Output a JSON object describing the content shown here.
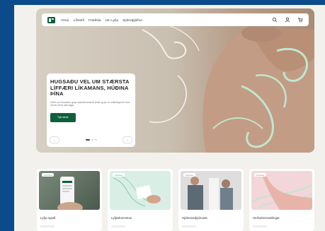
{
  "nav": {
    "items": [
      "Vörur",
      "Lífsstíll",
      "Fræðsla",
      "Um Lyfju",
      "Sjúkraþjálfun"
    ],
    "icons": [
      "search-icon",
      "user-icon",
      "cart-icon"
    ]
  },
  "hero": {
    "headline": "HUGSAÐU VEL UM STÆRSTA LÍFFÆRI LÍKAMANS, HÚÐINA ÞÍNA",
    "body": "Húðin ver líkamann gegn utanaðkomandi áreiti og því er mikilvægt að hlúa vel að henni alla daga.",
    "cta_label": "Sjá nánar",
    "prev_label": "‹",
    "next_label": "›"
  },
  "cards": [
    {
      "badge": "Þjónusta",
      "title": "Lyfju Appið"
    },
    {
      "badge": "Þjónusta",
      "title": "Lyfjaskömmtun"
    },
    {
      "badge": "Þjónusta",
      "title": "Hjúkrunarþjónusta"
    },
    {
      "badge": "Þjónusta",
      "title": "Heilsufarsmælingar"
    }
  ],
  "colors": {
    "frame": "#0b4a8b",
    "brand_green": "#0f5f3a",
    "mint": "#bfe6cf"
  }
}
